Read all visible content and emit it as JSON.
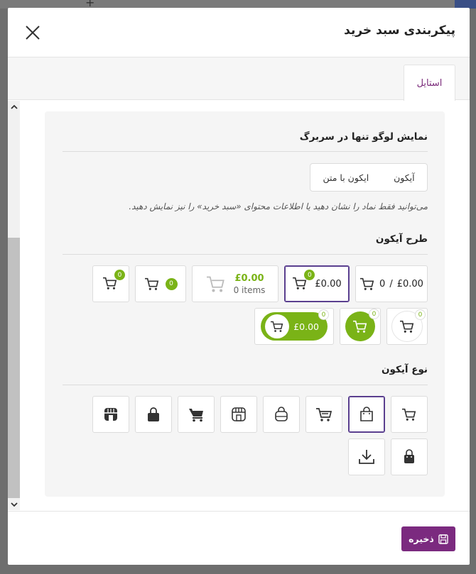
{
  "modal": {
    "title": "پیکربندی سبد خرید"
  },
  "tabs": [
    {
      "label": "استایل"
    }
  ],
  "sections": {
    "display_logo": {
      "title": "نمایش لوگو تنها در سربرگ"
    },
    "icon_design": {
      "title": "طرح آیکون"
    },
    "icon_type": {
      "title": "نوع آیکون"
    }
  },
  "toggle": {
    "options": [
      "آیکون",
      "ایکون با متن"
    ],
    "selected": "آیکون"
  },
  "help_text": "می‌توانید فقط نماد را نشان دهید یا اطلاعات محتوای «سبد خرید» را نیز نمایش دهید.",
  "designs": {
    "d1": {
      "price": "£0.00",
      "sep": "/",
      "count": "0"
    },
    "d2": {
      "price": "£0.00",
      "badge": "0"
    },
    "d3": {
      "price": "£0.00",
      "items": "0 items"
    },
    "d4": {
      "badge": "0"
    },
    "d5": {
      "badge": "0"
    },
    "d6": {
      "badge": "0"
    },
    "d7": {
      "badge": "0"
    },
    "d8": {
      "price": "£0.00",
      "badge": "0"
    }
  },
  "icon_types": [
    "cart-icon",
    "shopping-bag-icon",
    "cart-fast-icon",
    "handbag-icon",
    "store-icon",
    "cart-solid-icon",
    "lock-bag-icon",
    "shop-solid-icon",
    "bag-solid-icon",
    "download-icon"
  ],
  "footer": {
    "save_label": "ذخیره"
  },
  "colors": {
    "accent": "#7b2a7f",
    "green": "#7ab317",
    "selected_border": "#5a3f8f"
  }
}
